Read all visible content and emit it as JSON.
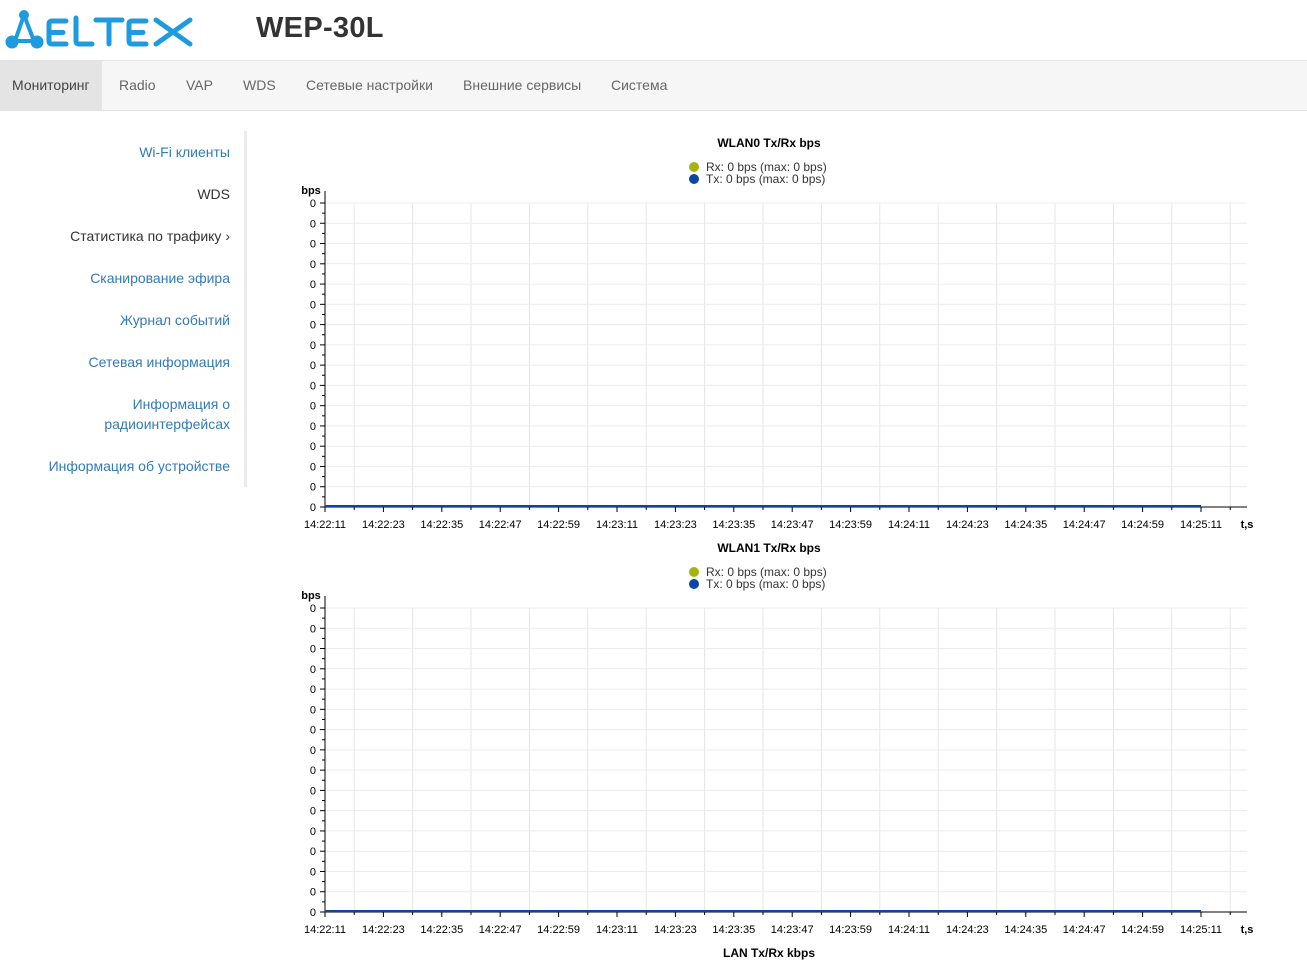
{
  "header": {
    "logo_text": "ELTEX",
    "model": "WEP-30L"
  },
  "nav": {
    "items": [
      {
        "label": "Мониторинг",
        "active": true
      },
      {
        "label": "Radio"
      },
      {
        "label": "VAP"
      },
      {
        "label": "WDS"
      },
      {
        "label": "Сетевые настройки"
      },
      {
        "label": "Внешние сервисы"
      },
      {
        "label": "Система"
      }
    ]
  },
  "sidebar": {
    "items": [
      {
        "label": "Wi-Fi клиенты"
      },
      {
        "label": "WDS"
      },
      {
        "label": "Статистика по трафику ›"
      },
      {
        "label": "Сканирование эфира"
      },
      {
        "label": "Журнал событий"
      },
      {
        "label": "Сетевая информация"
      },
      {
        "label": "Информация о радиоинтерфейсах"
      },
      {
        "label": "Информация об устройстве"
      }
    ]
  },
  "colors": {
    "rx": "#a5b50f",
    "tx": "#0b46a3",
    "link": "#337ab7"
  },
  "chart_data": [
    {
      "type": "line",
      "title": "WLAN0 Tx/Rx bps",
      "ylabel": "bps",
      "xlabel": "t,s",
      "legend": {
        "rx": "Rx: 0 bps (max: 0 bps)",
        "tx": "Tx: 0 bps (max: 0 bps)"
      },
      "y_ticks": [
        "0",
        "0",
        "0",
        "0",
        "0",
        "0",
        "0",
        "0",
        "0",
        "0",
        "0",
        "0",
        "0",
        "0",
        "0",
        "0"
      ],
      "x": [
        "14:22:11",
        "14:22:23",
        "14:22:35",
        "14:22:47",
        "14:22:59",
        "14:23:11",
        "14:23:23",
        "14:23:35",
        "14:23:47",
        "14:23:59",
        "14:24:11",
        "14:24:23",
        "14:24:35",
        "14:24:47",
        "14:24:59",
        "14:25:11"
      ],
      "series": [
        {
          "name": "Rx",
          "values": [
            0,
            0,
            0,
            0,
            0,
            0,
            0,
            0,
            0,
            0,
            0,
            0,
            0,
            0,
            0,
            0
          ]
        },
        {
          "name": "Tx",
          "values": [
            0,
            0,
            0,
            0,
            0,
            0,
            0,
            0,
            0,
            0,
            0,
            0,
            0,
            0,
            0,
            0
          ]
        }
      ]
    },
    {
      "type": "line",
      "title": "WLAN1 Tx/Rx bps",
      "ylabel": "bps",
      "xlabel": "t,s",
      "legend": {
        "rx": "Rx: 0 bps (max: 0 bps)",
        "tx": "Tx: 0 bps (max: 0 bps)"
      },
      "y_ticks": [
        "0",
        "0",
        "0",
        "0",
        "0",
        "0",
        "0",
        "0",
        "0",
        "0",
        "0",
        "0",
        "0",
        "0",
        "0",
        "0"
      ],
      "x": [
        "14:22:11",
        "14:22:23",
        "14:22:35",
        "14:22:47",
        "14:22:59",
        "14:23:11",
        "14:23:23",
        "14:23:35",
        "14:23:47",
        "14:23:59",
        "14:24:11",
        "14:24:23",
        "14:24:35",
        "14:24:47",
        "14:24:59",
        "14:25:11"
      ],
      "series": [
        {
          "name": "Rx",
          "values": [
            0,
            0,
            0,
            0,
            0,
            0,
            0,
            0,
            0,
            0,
            0,
            0,
            0,
            0,
            0,
            0
          ]
        },
        {
          "name": "Tx",
          "values": [
            0,
            0,
            0,
            0,
            0,
            0,
            0,
            0,
            0,
            0,
            0,
            0,
            0,
            0,
            0,
            0
          ]
        }
      ]
    },
    {
      "type": "line",
      "title": "LAN Tx/Rx kbps"
    }
  ]
}
